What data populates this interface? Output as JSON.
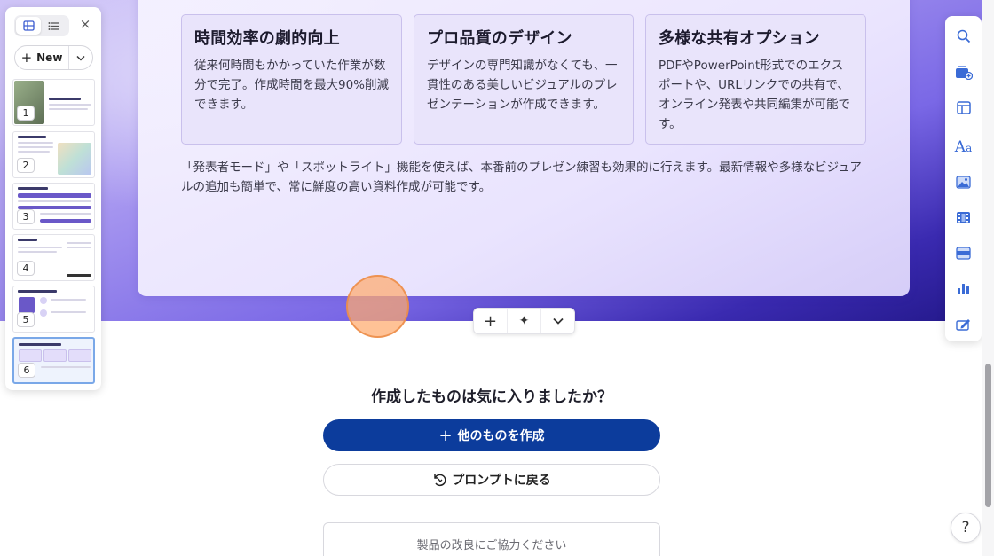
{
  "slide": {
    "features": [
      {
        "title": "時間効率の劇的向上",
        "text": "従来何時間もかかっていた作業が数分で完了。作成時間を最大90%削減できます。"
      },
      {
        "title": "プロ品質のデザイン",
        "text": "デザインの専門知識がなくても、一貫性のある美しいビジュアルのプレゼンテーションが作成できます。"
      },
      {
        "title": "多様な共有オプション",
        "text": "PDFやPowerPoint形式でのエクスポートや、URLリンクでの共有で、オンライン発表や共同編集が可能です。"
      }
    ],
    "body": "「発表者モード」や「スポットライト」機能を使えば、本番前のプレゼン練習も効果的に行えます。最新情報や多様なビジュアルの追加も簡単で、常に鮮度の高い資料作成が可能です。"
  },
  "slide_toolbar": {
    "add_glyph": "+",
    "ai_glyph": "✦",
    "more_glyph": "⌄"
  },
  "left_panel": {
    "close_glyph": "×",
    "new_label": "New",
    "new_plus": "+",
    "thumbnails": [
      {
        "num": "1"
      },
      {
        "num": "2"
      },
      {
        "num": "3"
      },
      {
        "num": "4"
      },
      {
        "num": "5"
      },
      {
        "num": "6"
      }
    ]
  },
  "feedback": {
    "question": "作成したものは気に入りましたか？",
    "create_other_label": "他のものを作成",
    "create_other_plus": "+",
    "back_to_prompt_label": "プロンプトに戻る",
    "improve_label": "製品の改良にご協力ください"
  },
  "help": {
    "label": "?"
  },
  "colors": {
    "primary_button": "#0c3c9c",
    "card_bg": "#e9e4fb",
    "background_gradient_end": "#23188a"
  }
}
